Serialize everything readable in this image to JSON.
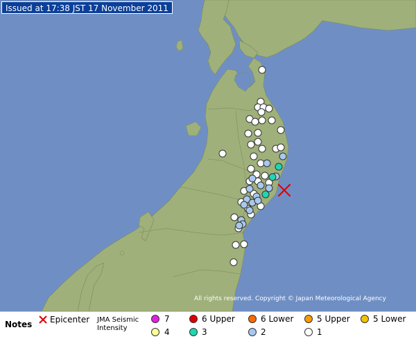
{
  "issued": "Issued at 17:38 JST  17 November 2011",
  "copyright": "All rights reserved. Copyright © Japan Meteorological Agency",
  "legend": {
    "notes": "Notes",
    "epicenter": "Epicenter",
    "scale_line1": "JMA Seismic",
    "scale_line2": "Intensity",
    "levels": [
      {
        "label": "7",
        "color": "#e020e0"
      },
      {
        "label": "6 Upper",
        "color": "#e00000"
      },
      {
        "label": "6 Lower",
        "color": "#ff6a00"
      },
      {
        "label": "5 Upper",
        "color": "#ff9a00"
      },
      {
        "label": "5 Lower",
        "color": "#f2c200"
      },
      {
        "label": "4",
        "color": "#ffff99"
      },
      {
        "label": "3",
        "color": "#20d6b0"
      },
      {
        "label": "2",
        "color": "#a8c8ee"
      },
      {
        "label": "1",
        "color": "#ffffff"
      }
    ]
  },
  "colors": {
    "sea": "#6f8fc4",
    "land": "#9fb07a",
    "epicenter_mark": "#e00000",
    "intensity_1": "#ffffff",
    "intensity_2": "#a8c8ee",
    "intensity_3": "#20d6b0"
  }
}
